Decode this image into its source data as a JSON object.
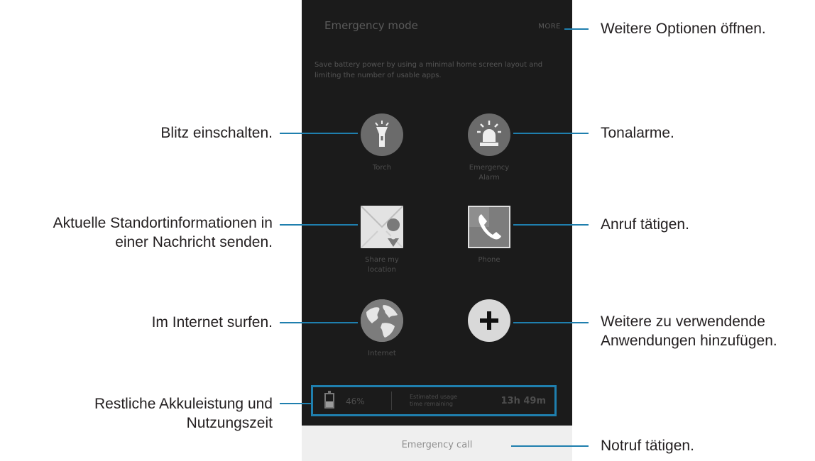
{
  "phone": {
    "title": "Emergency mode",
    "more": "MORE",
    "description": "Save battery power by using a minimal home screen layout and limiting the number of usable apps.",
    "apps": {
      "torch": {
        "label": "Torch",
        "icon": "flashlight-icon"
      },
      "alarm": {
        "label": "Emergency\nAlarm",
        "icon": "siren-icon"
      },
      "share": {
        "label": "Share my\nlocation",
        "icon": "mail-location-icon"
      },
      "phone": {
        "label": "Phone",
        "icon": "phone-icon"
      },
      "internet": {
        "label": "Internet",
        "icon": "globe-icon"
      },
      "add": {
        "icon": "plus-icon"
      }
    },
    "battery": {
      "percent": "46%",
      "level": 0.46,
      "estimated_label": "Estimated usage\ntime remaining",
      "remaining": "13h 49m"
    },
    "emergency_call": "Emergency call"
  },
  "callouts": {
    "more_options": "Weitere Optionen öffnen.",
    "torch": "Blitz einschalten.",
    "alarm": "Tonalarme.",
    "location_line1": "Aktuelle Standortinformationen in",
    "location_line2": "einer Nachricht senden.",
    "call": "Anruf tätigen.",
    "internet": "Im Internet surfen.",
    "add_line1": "Weitere zu verwendende",
    "add_line2": "Anwendungen hinzufügen.",
    "battery_line1": "Restliche Akkuleistung und",
    "battery_line2": "Nutzungszeit",
    "emergency": "Notruf tätigen."
  },
  "colors": {
    "accent": "#1f7fae",
    "screen_bg": "#1b1b1b",
    "icon_circle": "#6b6b6b"
  }
}
